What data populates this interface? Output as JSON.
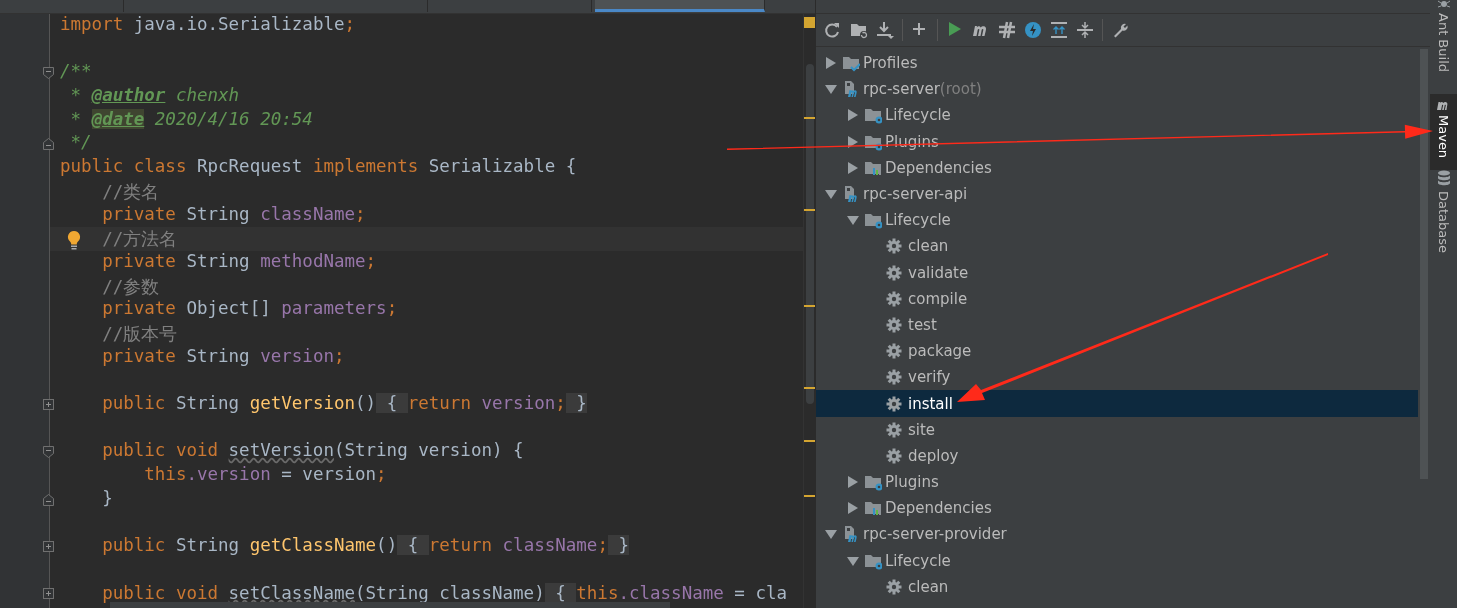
{
  "editor": {
    "tabs": [
      {
        "selected": false
      },
      {
        "selected": false
      },
      {
        "selected": false
      },
      {
        "selected": true
      }
    ],
    "lines": [
      {
        "kind": "top",
        "tokens": [
          {
            "kind": "kw",
            "text": "import "
          },
          {
            "kind": "plain",
            "text": "java.io.Serializable"
          },
          {
            "kind": "kw",
            "text": ";"
          }
        ]
      },
      {
        "kind": "blank"
      },
      {
        "kind": "top",
        "fold_marker": {
          "kind": "open"
        },
        "tokens": [
          {
            "kind": "doc",
            "text": "/**"
          }
        ]
      },
      {
        "kind": "top",
        "tokens": [
          {
            "kind": "doc",
            "text": " * "
          },
          {
            "kind": "doctag",
            "text": "@author"
          },
          {
            "kind": "doc",
            "text": " chenxh"
          }
        ]
      },
      {
        "kind": "top",
        "tokens": [
          {
            "kind": "doc",
            "text": " * "
          },
          {
            "kind": "doctag-marked",
            "text": "@date"
          },
          {
            "kind": "doc",
            "text": " 2020/4/16 20:54"
          }
        ]
      },
      {
        "kind": "top",
        "fold_marker": {
          "kind": "close"
        },
        "tokens": [
          {
            "kind": "doc",
            "text": " */"
          }
        ]
      },
      {
        "kind": "top",
        "tokens": [
          {
            "kind": "kw",
            "text": "public class "
          },
          {
            "kind": "plain",
            "text": "RpcRequest "
          },
          {
            "kind": "kw",
            "text": "implements "
          },
          {
            "kind": "plain",
            "text": "Serializable {"
          }
        ]
      },
      {
        "kind": "member",
        "tokens": [
          {
            "kind": "comment",
            "text": "//类名"
          }
        ]
      },
      {
        "kind": "member",
        "tokens": [
          {
            "kind": "kw",
            "text": "private "
          },
          {
            "kind": "plain",
            "text": "String "
          },
          {
            "kind": "field",
            "text": "className"
          },
          {
            "kind": "kw",
            "text": ";"
          }
        ]
      },
      {
        "kind": "member",
        "highlighted": true,
        "tokens": [
          {
            "kind": "comment",
            "text": "//方法名"
          }
        ]
      },
      {
        "kind": "member",
        "tokens": [
          {
            "kind": "kw",
            "text": "private "
          },
          {
            "kind": "plain",
            "text": "String "
          },
          {
            "kind": "field",
            "text": "methodName"
          },
          {
            "kind": "kw",
            "text": ";"
          }
        ]
      },
      {
        "kind": "member",
        "tokens": [
          {
            "kind": "comment",
            "text": "//参数"
          }
        ]
      },
      {
        "kind": "member",
        "tokens": [
          {
            "kind": "kw",
            "text": "private "
          },
          {
            "kind": "plain",
            "text": "Object[] "
          },
          {
            "kind": "field",
            "text": "parameters"
          },
          {
            "kind": "kw",
            "text": ";"
          }
        ]
      },
      {
        "kind": "member",
        "tokens": [
          {
            "kind": "comment",
            "text": "//版本号"
          }
        ]
      },
      {
        "kind": "member",
        "tokens": [
          {
            "kind": "kw",
            "text": "private "
          },
          {
            "kind": "plain",
            "text": "String "
          },
          {
            "kind": "field",
            "text": "version"
          },
          {
            "kind": "kw",
            "text": ";"
          }
        ]
      },
      {
        "kind": "blank"
      },
      {
        "kind": "member",
        "fold_marker": {
          "kind": "collapsed"
        },
        "tokens": [
          {
            "kind": "kw",
            "text": "public "
          },
          {
            "kind": "plain",
            "text": "String "
          },
          {
            "kind": "method",
            "text": "getVersion"
          },
          {
            "kind": "plain",
            "text": "()"
          },
          {
            "kind": "folded",
            "text": " { "
          },
          {
            "kind": "kw",
            "text": "return "
          },
          {
            "kind": "field",
            "text": "version"
          },
          {
            "kind": "kw",
            "text": ";"
          },
          {
            "kind": "folded",
            "text": " }"
          }
        ]
      },
      {
        "kind": "blank"
      },
      {
        "kind": "member",
        "fold_marker": {
          "kind": "open"
        },
        "tokens": [
          {
            "kind": "kw",
            "text": "public void "
          },
          {
            "kind": "unused",
            "text": "setVersion"
          },
          {
            "kind": "plain",
            "text": "(String version) {"
          }
        ]
      },
      {
        "kind": "statement",
        "tokens": [
          {
            "kind": "kw",
            "text": "this"
          },
          {
            "kind": "field",
            "text": ".version"
          },
          {
            "kind": "plain",
            "text": " = version"
          },
          {
            "kind": "kw",
            "text": ";"
          }
        ]
      },
      {
        "kind": "member",
        "fold_marker": {
          "kind": "close"
        },
        "tokens": [
          {
            "kind": "plain",
            "text": "}"
          }
        ]
      },
      {
        "kind": "blank"
      },
      {
        "kind": "member",
        "fold_marker": {
          "kind": "collapsed"
        },
        "tokens": [
          {
            "kind": "kw",
            "text": "public "
          },
          {
            "kind": "plain",
            "text": "String "
          },
          {
            "kind": "method",
            "text": "getClassName"
          },
          {
            "kind": "plain",
            "text": "()"
          },
          {
            "kind": "folded",
            "text": " { "
          },
          {
            "kind": "kw",
            "text": "return "
          },
          {
            "kind": "field",
            "text": "className"
          },
          {
            "kind": "kw",
            "text": ";"
          },
          {
            "kind": "folded",
            "text": " }"
          }
        ]
      },
      {
        "kind": "blank"
      },
      {
        "kind": "member",
        "fold_marker": {
          "kind": "collapsed"
        },
        "tokens": [
          {
            "kind": "kw",
            "text": "public void "
          },
          {
            "kind": "unused",
            "text": "setClassName"
          },
          {
            "kind": "plain",
            "text": "(String className)"
          },
          {
            "kind": "folded",
            "text": " { "
          },
          {
            "kind": "kw",
            "text": "this"
          },
          {
            "kind": "field",
            "text": ".className"
          },
          {
            "kind": "plain",
            "text": " = cla"
          }
        ]
      }
    ]
  },
  "maven": {
    "toolbar_groups": [
      {
        "buttons": [
          {
            "kind": "refresh"
          },
          {
            "kind": "folder-refresh"
          },
          {
            "kind": "download"
          }
        ]
      },
      {
        "buttons": [
          {
            "kind": "add"
          }
        ]
      },
      {
        "buttons": [
          {
            "kind": "run"
          },
          {
            "kind": "maven"
          },
          {
            "kind": "offline"
          },
          {
            "kind": "lightning"
          },
          {
            "kind": "expand"
          },
          {
            "kind": "collapse"
          }
        ]
      },
      {
        "buttons": [
          {
            "kind": "settings"
          }
        ]
      }
    ],
    "tree": [
      {
        "kind": "profiles",
        "label": "Profiles",
        "expanded": false,
        "selected": false
      },
      {
        "kind": "module",
        "label": "rpc-server",
        "note": "(root)",
        "expanded": true,
        "selected": false,
        "children": [
          {
            "kind": "lifecycle",
            "label": "Lifecycle",
            "expanded": false,
            "selected": false
          },
          {
            "kind": "plugins",
            "label": "Plugins",
            "expanded": false,
            "selected": false
          },
          {
            "kind": "dependencies",
            "label": "Dependencies",
            "expanded": false,
            "selected": false
          }
        ]
      },
      {
        "kind": "module",
        "label": "rpc-server-api",
        "expanded": true,
        "selected": false,
        "children": [
          {
            "kind": "lifecycle",
            "label": "Lifecycle",
            "expanded": true,
            "selected": false,
            "children": [
              {
                "kind": "goal",
                "label": "clean",
                "selected": false
              },
              {
                "kind": "goal",
                "label": "validate",
                "selected": false
              },
              {
                "kind": "goal",
                "label": "compile",
                "selected": false
              },
              {
                "kind": "goal",
                "label": "test",
                "selected": false
              },
              {
                "kind": "goal",
                "label": "package",
                "selected": false
              },
              {
                "kind": "goal",
                "label": "verify",
                "selected": false
              },
              {
                "kind": "goal",
                "label": "install",
                "selected": true
              },
              {
                "kind": "goal",
                "label": "site",
                "selected": false
              },
              {
                "kind": "goal",
                "label": "deploy",
                "selected": false
              }
            ]
          },
          {
            "kind": "plugins",
            "label": "Plugins",
            "expanded": false,
            "selected": false
          },
          {
            "kind": "dependencies",
            "label": "Dependencies",
            "expanded": false,
            "selected": false
          }
        ]
      },
      {
        "kind": "module",
        "label": "rpc-server-provider",
        "expanded": true,
        "selected": false,
        "children": [
          {
            "kind": "lifecycle",
            "label": "Lifecycle",
            "expanded": true,
            "selected": false,
            "children": [
              {
                "kind": "goal",
                "label": "clean",
                "selected": false
              }
            ]
          }
        ]
      }
    ]
  },
  "side_tabs": [
    {
      "kind": "ant",
      "label": "Ant Build",
      "selected": false
    },
    {
      "kind": "maven",
      "label": "Maven",
      "selected": true
    },
    {
      "kind": "database",
      "label": "Database",
      "selected": false
    }
  ]
}
